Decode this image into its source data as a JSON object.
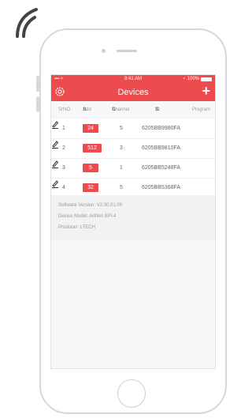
{
  "status_bar": {
    "time": "9:41 AM",
    "battery": "100%"
  },
  "header": {
    "title": "Devices",
    "add_label": "+"
  },
  "columns": [
    "SrNO.",
    "Add",
    "Channel",
    "ID",
    "Program"
  ],
  "devices": [
    {
      "srno": "1",
      "add": "24",
      "channel": "5",
      "id": "6205BB9980FA"
    },
    {
      "srno": "2",
      "add": "512",
      "channel": "3",
      "id": "6205BB9810FA"
    },
    {
      "srno": "3",
      "add": "5",
      "channel": "1",
      "id": "6205BB5248FA"
    },
    {
      "srno": "4",
      "add": "32",
      "channel": "5",
      "id": "6205BB5368FA"
    }
  ],
  "info": {
    "software_version": "Software Version:  V2.00.01.00",
    "device_model": "Device Model: ArtNet-SPI-4",
    "producer": "Producer:  LTECH"
  },
  "colors": {
    "accent": "#ee4b4f"
  }
}
